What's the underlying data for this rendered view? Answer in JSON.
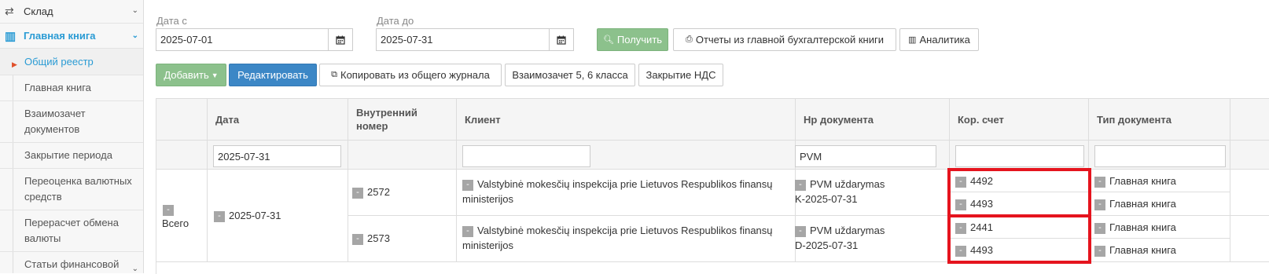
{
  "sidebar": {
    "top_item": {
      "label": "Склад"
    },
    "section": {
      "label": "Главная книга"
    },
    "items": [
      {
        "label": "Общий реестр"
      },
      {
        "label": "Главная книга"
      },
      {
        "label": "Взаимозачет документов"
      },
      {
        "label": "Закрытие периода"
      },
      {
        "label": "Переоценка валютных средств"
      },
      {
        "label": "Перерасчет обмена валюты"
      },
      {
        "label": "Статьи финансовой"
      }
    ]
  },
  "filters": {
    "date_from_label": "Дата с",
    "date_from_value": "2025-07-01",
    "date_to_label": "Дата до",
    "date_to_value": "2025-07-31"
  },
  "toolbar": {
    "get_label": "Получить",
    "reports_label": "Отчеты из главной бухгалтерской книги",
    "analytics_label": "Аналитика",
    "add_label": "Добавить",
    "edit_label": "Редактировать",
    "copy_label": "Копировать из общего журнала",
    "offset_label": "Взаимозачет 5, 6 класса",
    "vat_close_label": "Закрытие НДС"
  },
  "table": {
    "headers": {
      "date": "Дата",
      "internal_no": "Внутренний номер",
      "client": "Клиент",
      "doc_no": "Нр документа",
      "cor_account": "Кор. счет",
      "doc_type": "Тип документа"
    },
    "filters": {
      "date": "2025-07-31",
      "doc_no": "PVM"
    },
    "group": {
      "label": "Всего",
      "date": "2025-07-31",
      "minus": "-"
    },
    "rows": [
      {
        "internal_no": "2572",
        "client": "Valstybinė mokesčių inspekcija prie Lietuvos Respublikos finansų ministerijos",
        "doc_no_line1": "PVM uždarymas",
        "doc_no_line2": "K-2025-07-31",
        "accounts": [
          "4492",
          "4493"
        ],
        "doc_types": [
          "Главная книга",
          "Главная книга"
        ]
      },
      {
        "internal_no": "2573",
        "client": "Valstybinė mokesčių inspekcija prie Lietuvos Respublikos finansų ministerijos",
        "doc_no_line1": "PVM uždarymas",
        "doc_no_line2": "D-2025-07-31",
        "accounts": [
          "2441",
          "4493"
        ],
        "doc_types": [
          "Главная книга",
          "Главная книга"
        ]
      }
    ]
  },
  "colors": {
    "accent": "#2a9bd4",
    "green_button": "#8cc18c",
    "blue_button": "#3c87c6",
    "highlight": "#e5141e"
  }
}
